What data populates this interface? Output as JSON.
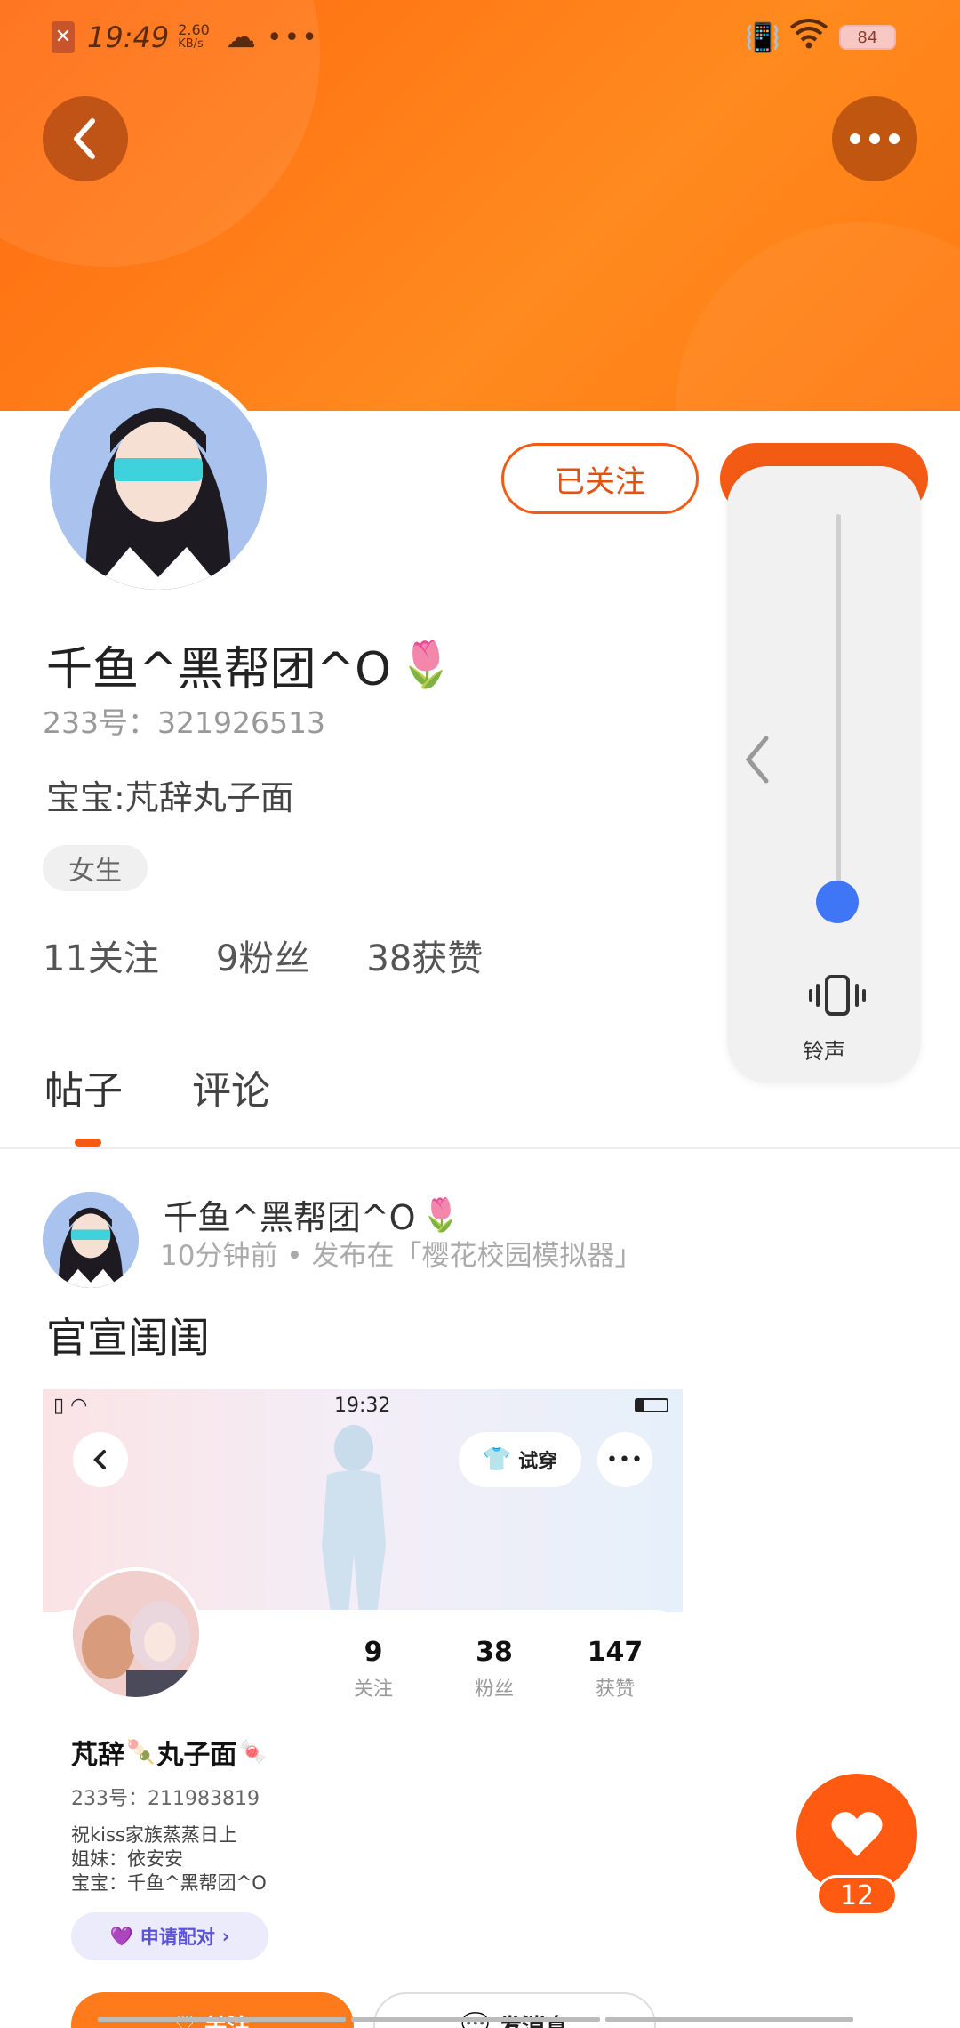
{
  "status_bar": {
    "time": "19:49",
    "speed_value": "2.60",
    "speed_unit": "KB/s",
    "battery": "84"
  },
  "profile": {
    "followed_label": "已关注",
    "name": "千鱼^黑帮团^O",
    "uid": "233号：321926513",
    "bio": "宝宝:芃辞丸子面",
    "gender_tag": "女生",
    "stats": {
      "following": "11关注",
      "fans": "9粉丝",
      "likes": "38获赞"
    }
  },
  "tabs": [
    {
      "label": "帖子",
      "active": true
    },
    {
      "label": "评论",
      "active": false
    }
  ],
  "volume_panel": {
    "mode_label": "铃声",
    "level": 0.0
  },
  "post": {
    "author": "千鱼^黑帮团^O",
    "meta": "10分钟前 • 发布在「樱花校园模拟器」",
    "title": "官宣闺闺",
    "screenshot": {
      "time": "19:32",
      "try_on_label": "试穿",
      "stats": [
        {
          "value": "9",
          "label": "关注"
        },
        {
          "value": "38",
          "label": "粉丝"
        },
        {
          "value": "147",
          "label": "获赞"
        }
      ],
      "name": "芃辞",
      "name_suffix": "丸子面",
      "uid": "233号：211983819",
      "bio_lines": [
        "祝kiss家族蒸蒸日上",
        "姐妹：依安安",
        "宝宝：千鱼^黑帮团^O"
      ],
      "pair_label": "申请配对",
      "follow_label": "关注",
      "message_label": "发消息"
    }
  },
  "like": {
    "count": "12"
  },
  "colors": {
    "accent": "#f35a14",
    "hero_gradient_start": "#ff6a10",
    "hero_gradient_end": "#ff8a1e",
    "volume_knob": "#3f76f5"
  }
}
